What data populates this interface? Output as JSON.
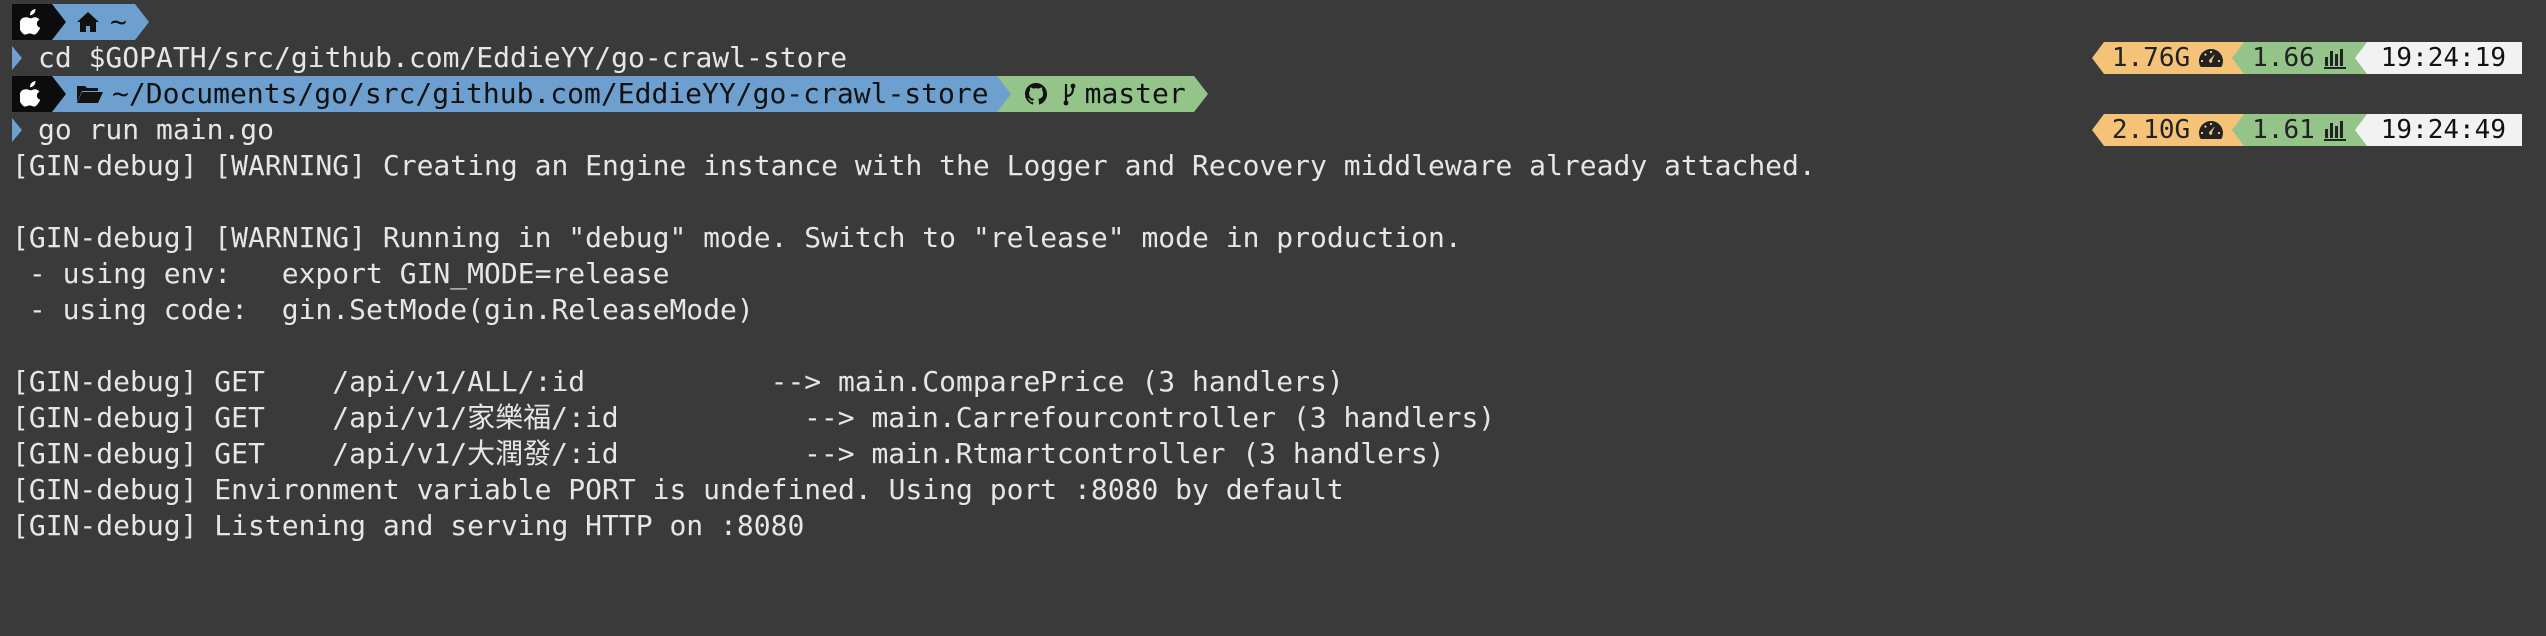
{
  "prompt1": {
    "dir_symbol": "~"
  },
  "cmd1": {
    "text": "cd $GOPATH/src/github.com/EddieYY/go-crawl-store"
  },
  "status1": {
    "memory": "1.76G",
    "load": "1.66",
    "time": "19:24:19"
  },
  "prompt2": {
    "path": "~/Documents/go/src/github.com/EddieYY/go-crawl-store",
    "branch": "master"
  },
  "cmd2": {
    "text": "go run main.go"
  },
  "status2": {
    "memory": "2.10G",
    "load": "1.61",
    "time": "19:24:49"
  },
  "output": [
    "[GIN-debug] [WARNING] Creating an Engine instance with the Logger and Recovery middleware already attached.",
    "",
    "[GIN-debug] [WARNING] Running in \"debug\" mode. Switch to \"release\" mode in production.",
    " - using env:   export GIN_MODE=release",
    " - using code:  gin.SetMode(gin.ReleaseMode)",
    "",
    "[GIN-debug] GET    /api/v1/ALL/:id           --> main.ComparePrice (3 handlers)",
    "[GIN-debug] GET    /api/v1/家樂福/:id           --> main.Carrefourcontroller (3 handlers)",
    "[GIN-debug] GET    /api/v1/大潤發/:id           --> main.Rtmartcontroller (3 handlers)",
    "[GIN-debug] Environment variable PORT is undefined. Using port :8080 by default",
    "[GIN-debug] Listening and serving HTTP on :8080"
  ],
  "colors": {
    "background": "#3a3a3a",
    "segment_dark": "#0c0c0c",
    "segment_blue": "#6ea0cf",
    "segment_green": "#94c48a",
    "segment_yellow": "#f4c377",
    "segment_white": "#f2f2f2",
    "text": "#e6e6e6"
  },
  "icons": {
    "os": "apple-icon",
    "home": "home-icon",
    "folder": "folder-open-icon",
    "vcs": "github-icon",
    "branch": "git-branch-icon",
    "memory": "dashboard-icon",
    "load": "bar-chart-icon",
    "prompt": "chevron-right-icon"
  }
}
